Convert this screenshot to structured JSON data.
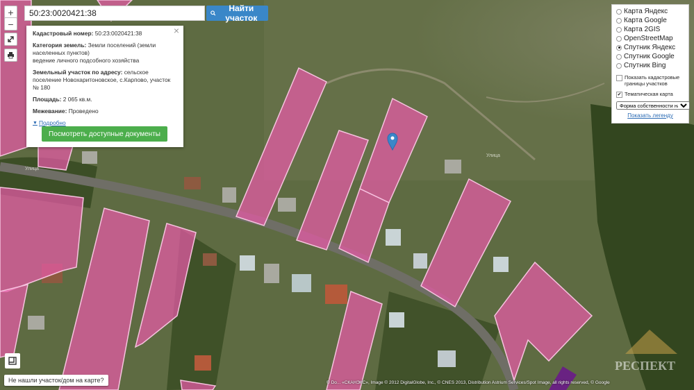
{
  "search": {
    "value": "50:23:0020421:38",
    "button_label": "Найти участок"
  },
  "controls": {
    "zoom_in": "+",
    "zoom_out": "−"
  },
  "info": {
    "cadastral_label": "Кадастровый номер:",
    "cadastral_value": "50:23:0020421:38",
    "category_label": "Категория земель:",
    "category_value": "Земли поселений (земли населенных пунктов)",
    "use_value": "ведение личного подсобного хозяйства",
    "address_label": "Земельный участок по адресу:",
    "address_value": "сельское поселение Новохаритоновское, с.Карпово, участок № 180",
    "area_label": "Площадь:",
    "area_value": "2 065 кв.м.",
    "survey_label": "Межевание:",
    "survey_value": "Проведено",
    "more_link": "Подробно",
    "docs_button": "Посмотреть доступные документы"
  },
  "layers": {
    "options": [
      "Карта Яндекс",
      "Карта Google",
      "Карта 2GIS",
      "OpenStreetMap",
      "Спутник Яндекс",
      "Спутник Google",
      "Спутник Bing"
    ],
    "selected_index": 4,
    "check_cadastral": "Показать кадастровые границы участков",
    "check_thematic": "Тематическая карта",
    "select_value": "Форма собственности на уч",
    "legend_link": "Показать легенду"
  },
  "not_found": "Не нашли участок/дом на карте?",
  "attribution": "© Do... «СКАНЭКС», Image © 2012 DigitalGlobe, Inc., © CNES 2013, Distribution Astrium Services/Spot Image, all rights reserved, © Google",
  "map_labels": {
    "watermark": "РЕСПЕКТ",
    "road_left": "Улица",
    "road_right": "Улица"
  },
  "colors": {
    "parcel": "#e85aa8",
    "marker": "#3a87c8",
    "button_green": "#4cae4c"
  }
}
